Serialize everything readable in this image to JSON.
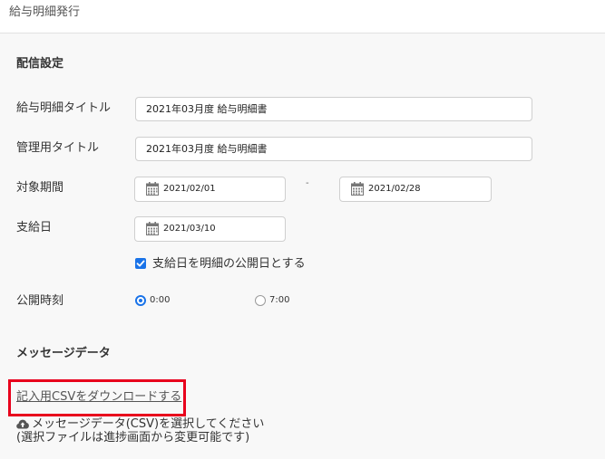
{
  "header": {
    "title": "給与明細発行"
  },
  "delivery_settings": {
    "section_title": "配信設定",
    "payslip_title": {
      "label": "給与明細タイトル",
      "value": "2021年03月度 給与明細書"
    },
    "admin_title": {
      "label": "管理用タイトル",
      "value": "2021年03月度 給与明細書"
    },
    "target_period": {
      "label": "対象期間",
      "start": "2021/02/01",
      "separator": "-",
      "end": "2021/02/28"
    },
    "payment_date": {
      "label": "支給日",
      "value": "2021/03/10"
    },
    "publish_on_payment_date": {
      "label": "支給日を明細の公開日とする",
      "checked": true
    },
    "publish_time": {
      "label": "公開時刻",
      "options": [
        {
          "label": "0:00",
          "selected": true
        },
        {
          "label": "7:00",
          "selected": false
        }
      ]
    }
  },
  "message_data": {
    "section_title": "メッセージデータ",
    "download_link": "記入用CSVをダウンロードする",
    "upload_prompt": "メッセージデータ(CSV)を選択してください",
    "upload_note": "(選択ファイルは進捗画面から変更可能です)"
  },
  "colors": {
    "accent": "#1a73e8",
    "highlight": "#e8001c"
  },
  "icons": {
    "calendar": "calendar-icon",
    "upload": "cloud-upload-icon",
    "check": "checkmark-icon"
  }
}
